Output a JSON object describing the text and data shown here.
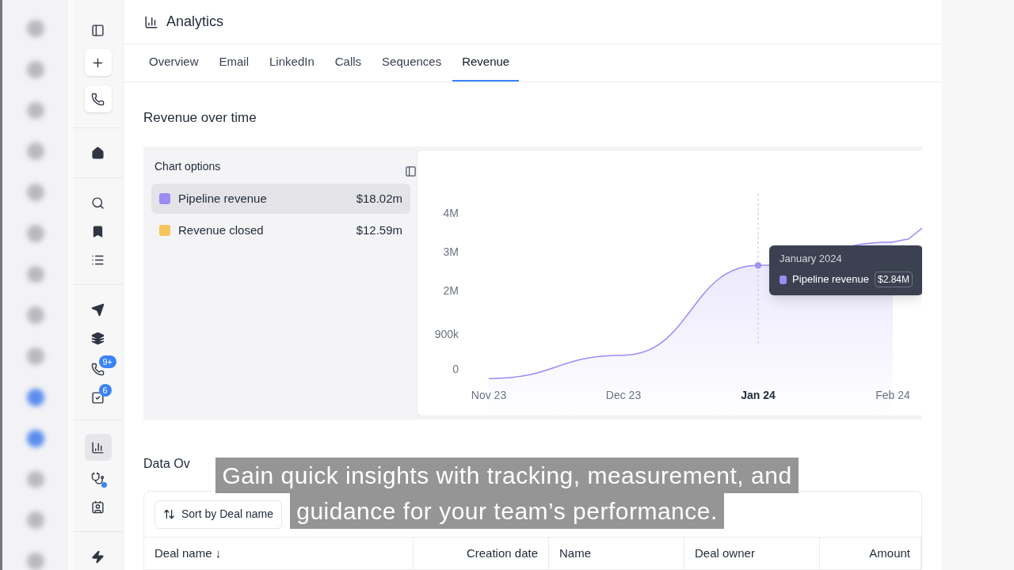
{
  "sidebar": {
    "items": [
      {
        "selected": false
      },
      {
        "selected": false
      },
      {
        "selected": false
      },
      {
        "selected": false
      },
      {
        "selected": false
      },
      {
        "selected": false
      },
      {
        "selected": false
      },
      {
        "selected": false
      },
      {
        "selected": false
      },
      {
        "selected": false,
        "badge": "9+"
      },
      {
        "selected": false,
        "badge": "6"
      },
      {
        "selected": true
      },
      {
        "selected": false,
        "dot": true
      },
      {
        "selected": false
      },
      {
        "selected": false
      }
    ]
  },
  "header": {
    "title": "Analytics"
  },
  "tabs": [
    {
      "label": "Overview",
      "selected": false
    },
    {
      "label": "Email",
      "selected": false
    },
    {
      "label": "LinkedIn",
      "selected": false
    },
    {
      "label": "Calls",
      "selected": false
    },
    {
      "label": "Sequences",
      "selected": false
    },
    {
      "label": "Revenue",
      "selected": true
    }
  ],
  "section_title": "Revenue over time",
  "chart_options": {
    "title": "Chart options",
    "items": [
      {
        "label": "Pipeline revenue",
        "value": "$18.02m",
        "color": "#9b8cf5",
        "selected": true
      },
      {
        "label": "Revenue closed",
        "value": "$12.59m",
        "color": "#f8c55c",
        "selected": false
      }
    ]
  },
  "chart": {
    "chart_data": {
      "type": "area",
      "categories": [
        "Nov 23",
        "Dec 23",
        "Jan 24",
        "Feb 24"
      ],
      "series": [
        {
          "name": "Pipeline revenue",
          "color": "#9b8cf5",
          "values": [
            -250000,
            350000,
            2650000,
            3250000
          ]
        }
      ],
      "yticks": [
        {
          "value": 0,
          "label": "0"
        },
        {
          "value": 900000,
          "label": "900k"
        },
        {
          "value": 2000000,
          "label": "2M"
        },
        {
          "value": 3000000,
          "label": "3M"
        },
        {
          "value": 4000000,
          "label": "4M"
        }
      ],
      "ylim": [
        -1200000,
        5600000
      ],
      "annotations": [
        {
          "x": "Jan 24"
        }
      ]
    },
    "tooltip": {
      "title": "January 2024",
      "value": "$2.84M",
      "color": "#9b8cf5"
    }
  },
  "data_section": {
    "title": "Data Ov",
    "sort_label": "Sort by Deal name",
    "columns": [
      "Deal name ↓",
      "Creation date",
      "Name",
      "Deal owner",
      "Amount"
    ]
  },
  "caption": {
    "lines": [
      "Gain quick insights with tracking, measurement, and",
      "guidance for your team’s performance."
    ]
  }
}
